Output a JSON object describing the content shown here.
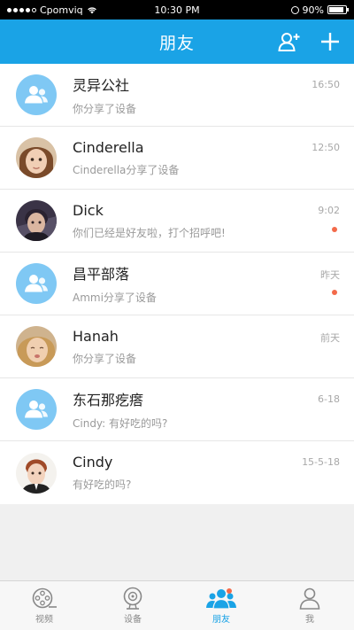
{
  "status_bar": {
    "carrier": "Cpomviq",
    "time": "10:30 PM",
    "battery": "90%",
    "battery_level": 0.9
  },
  "nav": {
    "title": "朋友",
    "add_friend_icon": "add-person-icon",
    "add_icon": "plus-icon"
  },
  "friends": [
    {
      "name": "灵异公社",
      "message": "你分享了设备",
      "time": "16:50",
      "avatar": "group",
      "unread": false
    },
    {
      "name": "Cinderella",
      "message": "Cinderella分享了设备",
      "time": "12:50",
      "avatar": "photo",
      "unread": false
    },
    {
      "name": "Dick",
      "message": "你们已经是好友啦，打个招呼吧!",
      "time": "9:02",
      "avatar": "photo",
      "unread": true
    },
    {
      "name": "昌平部落",
      "message": "Ammi分享了设备",
      "time": "昨天",
      "avatar": "group",
      "unread": true
    },
    {
      "name": "Hanah",
      "message": "你分享了设备",
      "time": "前天",
      "avatar": "photo",
      "unread": false
    },
    {
      "name": "东石那疙瘩",
      "message": "Cindy: 有好吃的吗?",
      "time": "6-18",
      "avatar": "group",
      "unread": false
    },
    {
      "name": "Cindy",
      "message": "有好吃的吗?",
      "time": "15-5-18",
      "avatar": "photo",
      "unread": false
    }
  ],
  "tabs": [
    {
      "label": "视频",
      "icon": "film-reel-icon",
      "active": false
    },
    {
      "label": "设备",
      "icon": "camera-device-icon",
      "active": false
    },
    {
      "label": "朋友",
      "icon": "friends-icon",
      "active": true
    },
    {
      "label": "我",
      "icon": "person-icon",
      "active": false
    }
  ],
  "colors": {
    "accent": "#1aa3e6",
    "group_avatar": "#7fc8f4",
    "unread_dot": "#f36a4a"
  }
}
